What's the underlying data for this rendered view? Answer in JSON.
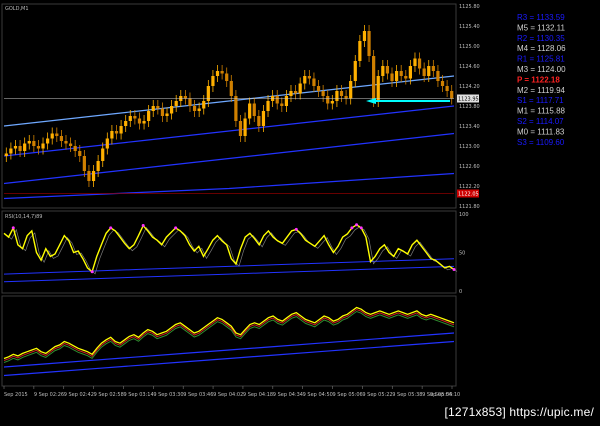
{
  "title": "GOLD,M1",
  "indicator_label": "RSI(10,14,7)89",
  "footer": "[1271x853] https://upic.me/",
  "colors": {
    "background": "#000000",
    "candle_up": "#ffb000",
    "candle_down": "#d08000",
    "band_blue": "#2233ff",
    "band_light": "#6fa8ff",
    "rsi_line": "#ffff00",
    "rsi_marker": "#ff33ff",
    "pivot_P": "#ff2222",
    "arrow": "#00ffff"
  },
  "pivots": [
    {
      "key": "R3",
      "label": "R3 = 1133.59",
      "color": "#1a1aff"
    },
    {
      "key": "M5",
      "label": "M5 = 1132.11",
      "color": "#d0d0d0"
    },
    {
      "key": "R2",
      "label": "R2 = 1130.35",
      "color": "#1a1aff"
    },
    {
      "key": "M4",
      "label": "M4 = 1128.06",
      "color": "#d0d0d0"
    },
    {
      "key": "R1",
      "label": "R1 = 1125.81",
      "color": "#1a1aff"
    },
    {
      "key": "M3",
      "label": "M3 = 1124.00",
      "color": "#d0d0d0"
    },
    {
      "key": "P",
      "label": "P = 1122.18",
      "color": "#ff2222"
    },
    {
      "key": "M2",
      "label": "M2 = 1119.94",
      "color": "#d0d0d0"
    },
    {
      "key": "S1",
      "label": "S1 = 1117.71",
      "color": "#1a1aff"
    },
    {
      "key": "M1",
      "label": "M1 = 1115.88",
      "color": "#d0d0d0"
    },
    {
      "key": "S2",
      "label": "S2 = 1114.07",
      "color": "#1a1aff"
    },
    {
      "key": "M0",
      "label": "M0 = 1111.83",
      "color": "#d0d0d0"
    },
    {
      "key": "S3",
      "label": "S3 = 1109.60",
      "color": "#1a1aff"
    }
  ],
  "chart_data": [
    {
      "type": "line",
      "panel": "price",
      "title": "GOLD,M1",
      "ylim": [
        1121.8,
        1125.8
      ],
      "y_ticks": [
        "1125.80",
        "1125.40",
        "1125.00",
        "1124.60",
        "1124.20",
        "1123.80",
        "1123.40",
        "1123.00",
        "1122.60",
        "1122.20",
        "1121.80"
      ],
      "current_price": "1123.95",
      "current_price_value": 1123.95,
      "lower_line_value": 1122.05,
      "lower_line_label": "1122.05",
      "close": [
        1122.85,
        1122.95,
        1123.0,
        1122.9,
        1123.05,
        1123.1,
        1123.0,
        1122.95,
        1123.05,
        1123.15,
        1123.25,
        1123.2,
        1123.1,
        1123.05,
        1123.0,
        1122.9,
        1122.8,
        1122.5,
        1122.3,
        1122.5,
        1122.7,
        1122.95,
        1123.15,
        1123.3,
        1123.25,
        1123.4,
        1123.5,
        1123.6,
        1123.55,
        1123.45,
        1123.5,
        1123.7,
        1123.8,
        1123.75,
        1123.6,
        1123.65,
        1123.8,
        1123.9,
        1124.0,
        1123.95,
        1123.8,
        1123.7,
        1123.75,
        1123.9,
        1124.2,
        1124.4,
        1124.5,
        1124.45,
        1124.3,
        1124.0,
        1123.5,
        1123.2,
        1123.55,
        1123.85,
        1123.6,
        1123.4,
        1123.7,
        1123.9,
        1124.0,
        1123.85,
        1123.8,
        1124.0,
        1124.1,
        1124.05,
        1124.25,
        1124.4,
        1124.35,
        1124.2,
        1124.1,
        1124.0,
        1123.85,
        1123.9,
        1124.1,
        1124.0,
        1123.95,
        1124.3,
        1124.7,
        1125.1,
        1125.3,
        1124.8,
        1123.9,
        1124.4,
        1124.6,
        1124.45,
        1124.3,
        1124.5,
        1124.4,
        1124.35,
        1124.6,
        1124.75,
        1124.55,
        1124.4,
        1124.6,
        1124.5,
        1124.3,
        1124.2,
        1124.1,
        1123.95
      ],
      "series": [
        {
          "name": "",
          "values": [
            1123.4,
            1123.45,
            1123.5,
            1123.55,
            1123.6,
            1123.65,
            1123.7,
            1123.75,
            1123.8,
            1123.85,
            1123.9,
            1123.95,
            1124.0,
            1124.05,
            1124.1,
            1124.15,
            1124.2,
            1124.25,
            1124.3,
            1124.35,
            1124.4
          ]
        },
        {
          "name": "",
          "values": [
            1122.8,
            1122.85,
            1122.9,
            1122.95,
            1123.0,
            1123.05,
            1123.1,
            1123.15,
            1123.2,
            1123.25,
            1123.3,
            1123.35,
            1123.4,
            1123.45,
            1123.5,
            1123.55,
            1123.6,
            1123.65,
            1123.7,
            1123.75,
            1123.8
          ]
        },
        {
          "name": "",
          "values": [
            1122.25,
            1122.3,
            1122.35,
            1122.4,
            1122.45,
            1122.5,
            1122.55,
            1122.6,
            1122.65,
            1122.7,
            1122.75,
            1122.8,
            1122.85,
            1122.9,
            1122.95,
            1123.0,
            1123.05,
            1123.1,
            1123.15,
            1123.2,
            1123.25
          ]
        },
        {
          "name": "",
          "values": [
            1121.95,
            1121.97,
            1121.99,
            1122.01,
            1122.03,
            1122.05,
            1122.07,
            1122.09,
            1122.11,
            1122.13,
            1122.15,
            1122.18,
            1122.21,
            1122.24,
            1122.27,
            1122.3,
            1122.33,
            1122.36,
            1122.39,
            1122.42,
            1122.45
          ]
        }
      ]
    },
    {
      "type": "line",
      "panel": "rsi",
      "title": "RSI(10,14,7)89",
      "ylim": [
        0,
        100
      ],
      "y_ticks": [
        "100",
        "50",
        "0"
      ],
      "values": [
        75,
        70,
        82,
        60,
        55,
        72,
        78,
        50,
        40,
        55,
        45,
        48,
        60,
        72,
        65,
        50,
        52,
        42,
        30,
        25,
        45,
        60,
        75,
        82,
        78,
        70,
        62,
        55,
        60,
        72,
        85,
        78,
        70,
        66,
        60,
        70,
        76,
        82,
        78,
        72,
        60,
        52,
        58,
        45,
        55,
        66,
        72,
        65,
        60,
        42,
        35,
        55,
        70,
        75,
        68,
        60,
        72,
        78,
        70,
        65,
        62,
        70,
        78,
        80,
        74,
        66,
        62,
        58,
        65,
        72,
        60,
        50,
        58,
        70,
        74,
        82,
        86,
        82,
        70,
        38,
        45,
        55,
        60,
        50,
        45,
        55,
        52,
        48,
        60,
        66,
        58,
        50,
        42,
        40,
        35,
        30,
        32,
        28
      ],
      "series": [
        {
          "name": "",
          "values": [
            22,
            24,
            26,
            28,
            30,
            32,
            34,
            36,
            38,
            40,
            42
          ]
        },
        {
          "name": "",
          "values": [
            12,
            14,
            16,
            18,
            20,
            22,
            24,
            26,
            28,
            30,
            32
          ]
        }
      ]
    },
    {
      "type": "line",
      "panel": "lower",
      "values": [
        30,
        32,
        35,
        33,
        36,
        38,
        40,
        42,
        38,
        36,
        40,
        44,
        46,
        50,
        48,
        45,
        42,
        40,
        38,
        35,
        42,
        48,
        52,
        55,
        50,
        48,
        52,
        56,
        58,
        55,
        60,
        64,
        62,
        58,
        60,
        62,
        66,
        70,
        72,
        68,
        64,
        60,
        62,
        66,
        70,
        74,
        78,
        76,
        72,
        68,
        60,
        58,
        64,
        70,
        72,
        70,
        74,
        78,
        80,
        76,
        74,
        78,
        82,
        84,
        80,
        76,
        74,
        72,
        76,
        80,
        78,
        74,
        76,
        80,
        82,
        86,
        90,
        88,
        84,
        82,
        84,
        86,
        84,
        82,
        84,
        86,
        84,
        82,
        84,
        86,
        82,
        80,
        82,
        80,
        78,
        76,
        74,
        72
      ],
      "series": [
        {
          "name": "",
          "values": [
            20,
            24,
            28,
            32,
            36,
            40,
            44,
            48,
            52,
            56,
            60
          ]
        },
        {
          "name": "",
          "values": [
            10,
            14,
            18,
            22,
            26,
            30,
            34,
            38,
            42,
            46,
            50
          ]
        }
      ]
    }
  ],
  "x_ticks": [
    "Sep 2015",
    "9 Sep 02:26",
    "9 Sep 02:42",
    "9 Sep 02:58",
    "9 Sep 03:14",
    "9 Sep 03:30",
    "9 Sep 03:46",
    "9 Sep 04:02",
    "9 Sep 04:18",
    "9 Sep 04:34",
    "9 Sep 04:50",
    "9 Sep 05:06",
    "9 Sep 05:22",
    "9 Sep 05:38",
    "9 Sep 05:54",
    "9 Sep 06:10"
  ]
}
